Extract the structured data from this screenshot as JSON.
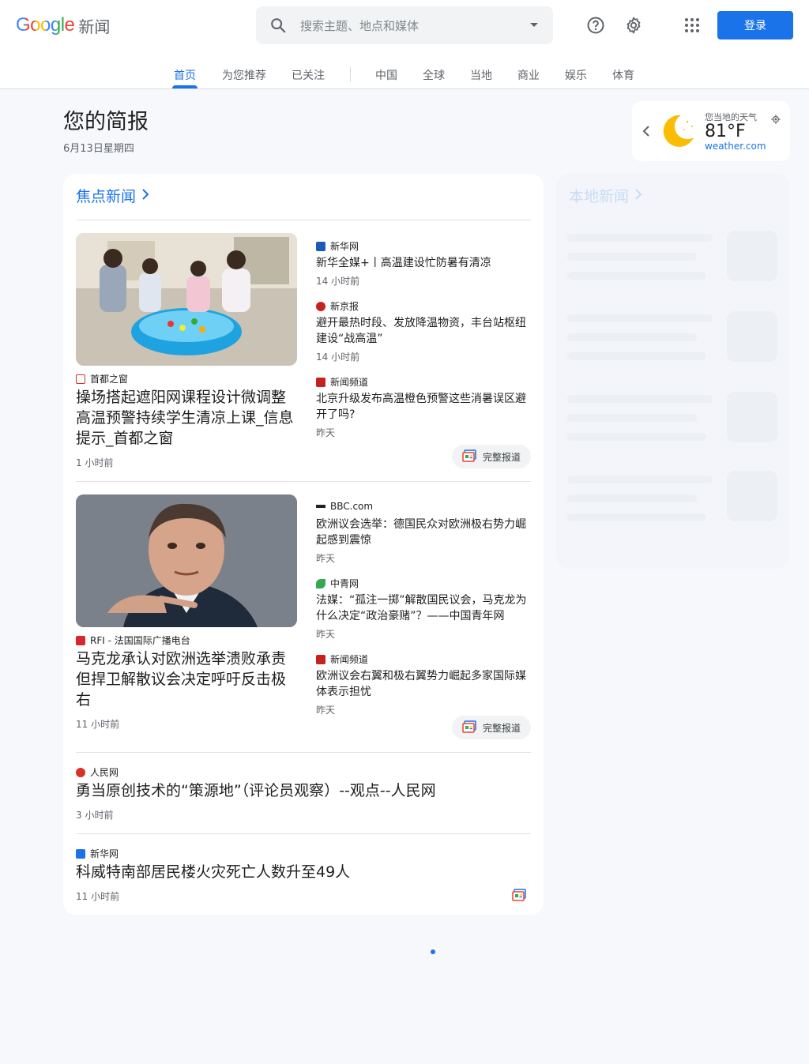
{
  "header": {
    "logo_google": "Google",
    "logo_news": "新闻",
    "search_placeholder": "搜索主题、地点和媒体",
    "login_label": "登录"
  },
  "tabs": [
    {
      "label": "首页",
      "active": true
    },
    {
      "label": "为您推荐"
    },
    {
      "label": "已关注"
    },
    {
      "label": "中国"
    },
    {
      "label": "全球"
    },
    {
      "label": "当地"
    },
    {
      "label": "商业"
    },
    {
      "label": "娱乐"
    },
    {
      "label": "体育"
    }
  ],
  "briefing": {
    "title": "您的简报",
    "date": "6月13日星期四"
  },
  "weather": {
    "label": "您当地的天气",
    "temp": "81°F",
    "source": "weather.com"
  },
  "top_stories": {
    "title": "焦点新闻",
    "full_coverage_label": "完整报道",
    "clusters": [
      {
        "main": {
          "source": "首都之窗",
          "headline": "操场搭起遮阳网课程设计微调整高温预警持续学生清凉上课_信息提示_首都之窗",
          "time": "1 小时前"
        },
        "related": [
          {
            "source": "新华网",
            "headline": "新华全媒+丨高温建设忙防暑有清凉",
            "time": "14 小时前"
          },
          {
            "source": "新京报",
            "headline": "避开最热时段、发放降温物资，丰台站枢纽建设“战高温”",
            "time": "14 小时前"
          },
          {
            "source": "新闻频道",
            "headline": "北京升级发布高温橙色预警这些消暑误区避开了吗?",
            "time": "昨天"
          }
        ]
      },
      {
        "main": {
          "source": "RFI - 法国国际广播电台",
          "headline": "马克龙承认对欧洲选举溃败承责但捍卫解散议会决定呼吁反击极右",
          "time": "11 小时前"
        },
        "related": [
          {
            "source": "BBC.com",
            "headline": "欧洲议会选举：德国民众对欧洲极右势力崛起感到震惊",
            "time": "昨天"
          },
          {
            "source": "中青网",
            "headline": "法媒：“孤注一掷”解散国民议会，马克龙为什么决定“政治豪赌”？——中国青年网",
            "time": "昨天"
          },
          {
            "source": "新闻频道",
            "headline": "欧洲议会右翼和极右翼势力崛起多家国际媒体表示担忧",
            "time": "昨天"
          }
        ]
      }
    ],
    "singles": [
      {
        "source": "人民网",
        "headline": "勇当原创技术的“策源地”（评论员观察）--观点--人民网",
        "time": "3 小时前"
      },
      {
        "source": "新华网",
        "headline": "科威特南部居民楼火灾死亡人数升至49人",
        "time": "11 小时前"
      }
    ]
  },
  "local_news": {
    "title": "本地新闻"
  },
  "colors": {
    "accent": "#1a73e8",
    "background": "#f6f8fc"
  }
}
